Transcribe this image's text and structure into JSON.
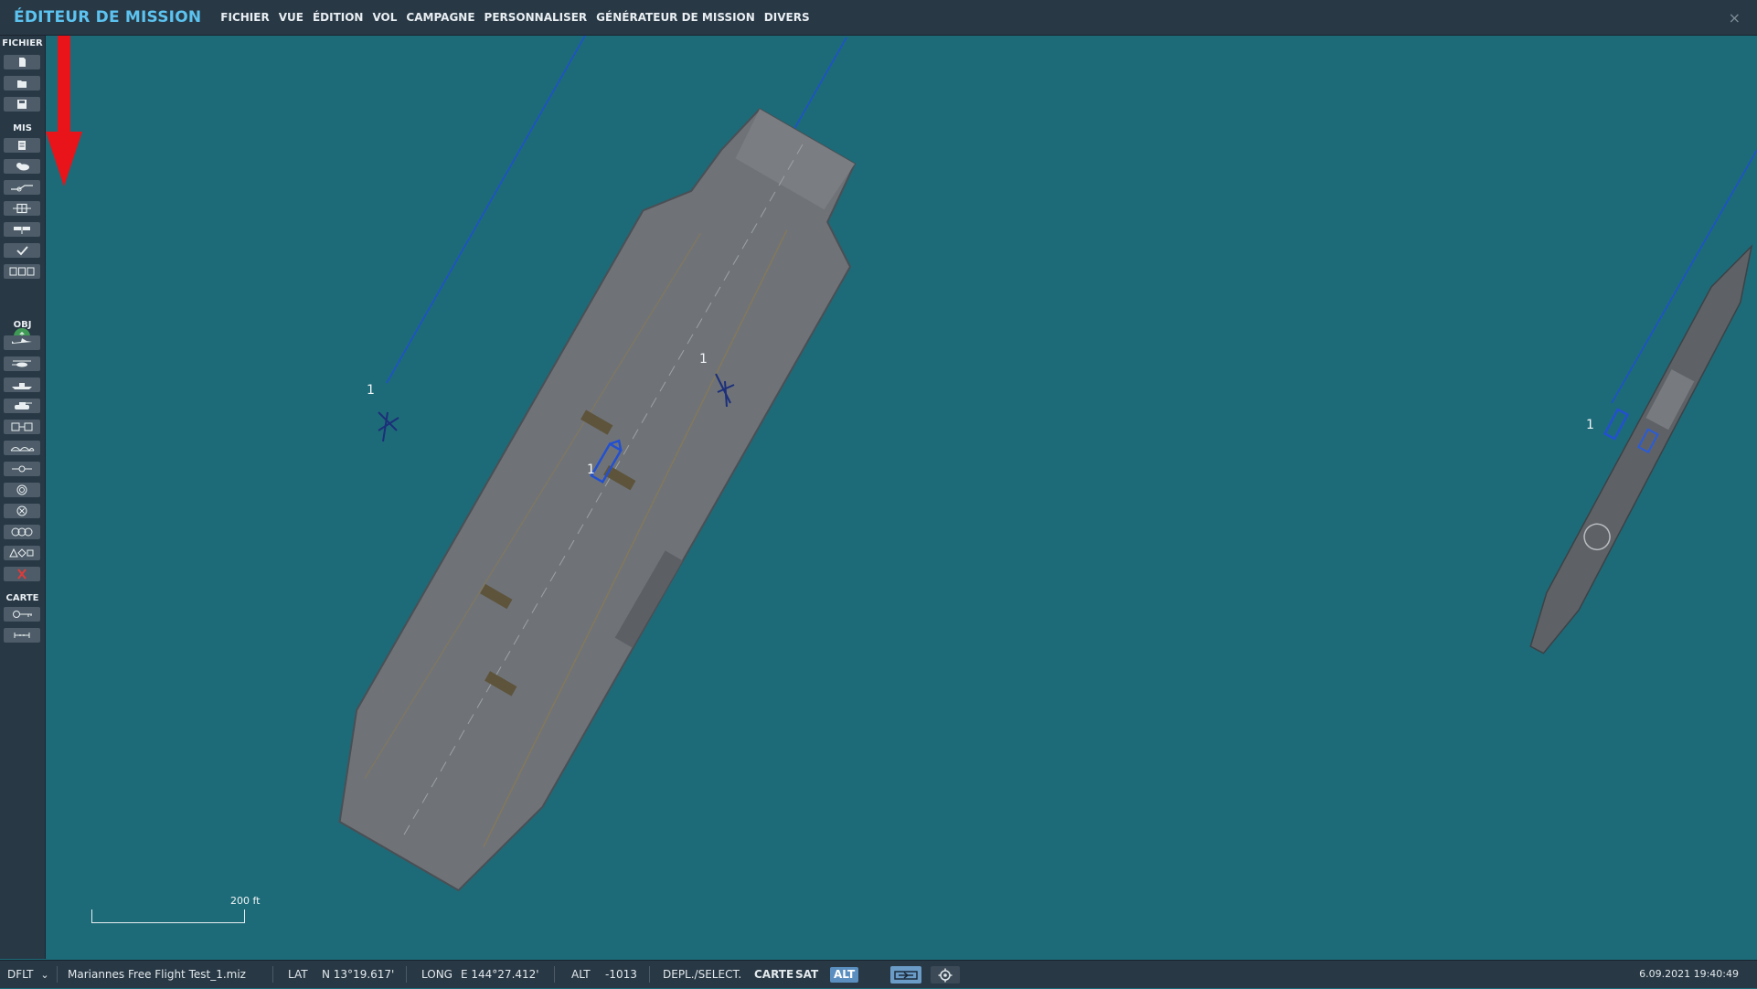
{
  "app": {
    "title": "ÉDITEUR DE MISSION",
    "close_glyph": "×"
  },
  "menu": [
    "FICHIER",
    "VUE",
    "ÉDITION",
    "VOL",
    "CAMPAGNE",
    "PERSONNALISER",
    "GÉNÉRATEUR DE MISSION",
    "DIVERS"
  ],
  "toolbar": {
    "sections": {
      "file": "FICHIER",
      "mission": "MIS",
      "objects": "OBJ",
      "map": "CARTE"
    },
    "file_buttons": [
      "new-file-icon",
      "open-folder-icon",
      "save-icon"
    ],
    "mission_buttons": [
      "briefing-icon",
      "weather-icon",
      "waypoint-route-icon",
      "trigger-zone-icon",
      "flag-icon",
      "checkmark-icon",
      "trigger-chain-icon"
    ],
    "green_button_glyph": "↑",
    "object_buttons": [
      "airplane-icon",
      "helicopter-icon",
      "ship-icon",
      "ground-vehicle-icon",
      "static-object-icon",
      "bridge-icon",
      "nav-point-icon",
      "target-icon",
      "crosshair-zone-icon",
      "cluster-icon",
      "shapes-icon",
      "delete-icon"
    ],
    "map_buttons": [
      "key-icon",
      "measure-ruler-icon"
    ],
    "red_button_glyph": "●"
  },
  "map": {
    "unit_labels": [
      "1",
      "1",
      "1",
      "1"
    ],
    "scale_label": "200 ft",
    "colors": {
      "sea": "#1d6b78",
      "route": "#1f4fd1",
      "arrow": "#e8141a"
    }
  },
  "status": {
    "profile": "DFLT",
    "profile_chevron": "⌄",
    "mission_file": "Mariannes Free Flight Test_1.miz",
    "lat_label": "LAT",
    "lat_value": "N 13°19.617'",
    "long_label": "LONG",
    "long_value": "E 144°27.412'",
    "alt_label": "ALT",
    "alt_value": "-1013",
    "mode_label": "DEPL./SELECT.",
    "map_toggles": [
      "CARTE",
      "SAT",
      "ALT"
    ],
    "active_toggle": "ALT",
    "datetime": "6.09.2021 19:40:49"
  }
}
